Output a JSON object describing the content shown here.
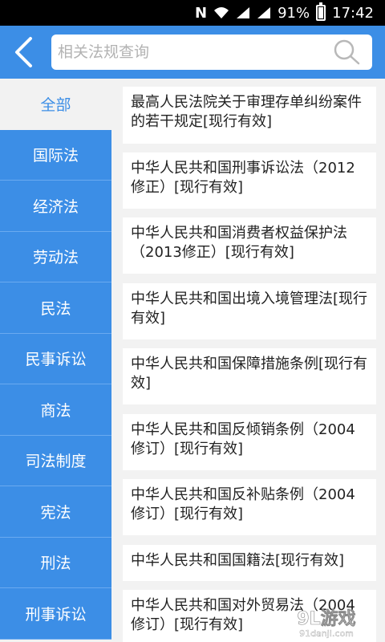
{
  "statusbar": {
    "battery": "91%",
    "time": "17:42",
    "icons": [
      "n-icon",
      "wifi-icon",
      "signal-icon",
      "signal-icon",
      "battery-icon"
    ]
  },
  "header": {
    "search_placeholder": "相关法规查询",
    "search_value": ""
  },
  "sidebar": {
    "items": [
      "全部",
      "国际法",
      "经济法",
      "劳动法",
      "民法",
      "民事诉讼",
      "商法",
      "司法制度",
      "宪法",
      "刑法",
      "刑事诉讼"
    ],
    "active_index": 0
  },
  "laws": [
    "最高人民法院关于审理存单纠纷案件的若干规定[现行有效]",
    "中华人民共和国刑事诉讼法（2012修正）[现行有效]",
    "中华人民共和国消费者权益保护法（2013修正）[现行有效]",
    "中华人民共和国出境入境管理法[现行有效]",
    "中华人民共和国保障措施条例[现行有效]",
    "中华人民共和国反倾销条例（2004修订）[现行有效]",
    "中华人民共和国反补贴条例（2004修订）[现行有效]",
    "中华人民共和国国籍法[现行有效]",
    "中华人民共和国对外贸易法（2004修订）[现行有效]"
  ],
  "watermark": {
    "brand": "9L游戏",
    "url": "91danji.com"
  },
  "colors": {
    "primary": "#3c8ee6",
    "background": "#f2f2f2",
    "card": "#ffffff"
  }
}
